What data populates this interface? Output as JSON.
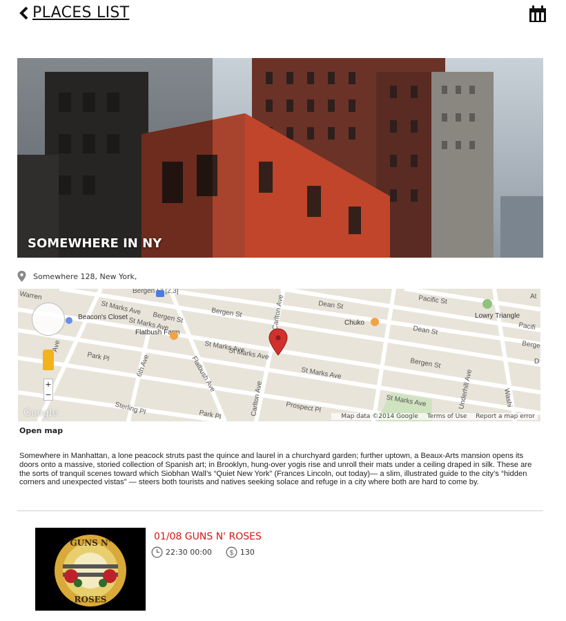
{
  "header": {
    "back_label": "PLACES LIST",
    "back_icon": "chevron-left-icon",
    "calendar_icon": "calendar-icon"
  },
  "place": {
    "title": "SOMEWHERE IN NY",
    "address": "Somewhere 128, New York,",
    "open_map_label": "Open map",
    "description": "Somewhere in Manhattan, a lone peacock struts past the quince and laurel in a churchyard garden; further uptown, a Beaux-Arts mansion opens its doors onto a massive, storied collection of Spanish art; in Brooklyn, hung-over yogis rise and unroll their mats under a ceiling draped in silk. These are the sorts of tranquil scenes toward which Siobhan Wall’s “Quiet New York” (Frances Lincoln, out today)— a slim, illustrated guide to the city’s “hidden corners and unexpected vistas” — steers both tourists and natives seeking solace and refuge in a city where both are hard to come by."
  },
  "map": {
    "streets": [
      "Bergen St",
      "St Marks Ave",
      "Dean St",
      "Pacific St",
      "Park Pl",
      "Sterling Pl",
      "Prospect Pl",
      "Flatbush Ave",
      "6th Ave",
      "Carlton Ave",
      "Underhill Ave",
      "Washi",
      "St Marks Ave",
      "Bergen St",
      "Dean St",
      "Park Pl",
      "At",
      "Pacifi",
      "St Marks Ave",
      "Warren",
      "Bergen St [2,3]",
      "Bergen St",
      "St Marks Ave",
      "Ave",
      "Carlton Ave",
      "D",
      "Bergen St",
      "St Marks Ave",
      "St Marks Ave"
    ],
    "pois": [
      "Beacon's Closet",
      "Flatbush Farm",
      "Chuko",
      "Lowry Triangle"
    ],
    "google_label": "Google",
    "footer": {
      "data": "Map data ©2014 Google",
      "terms": "Terms of Use",
      "report": "Report a map error"
    },
    "zoom_in": "+",
    "zoom_out": "−",
    "pin_color": "#d0312d"
  },
  "event": {
    "date_title": "01/08  GUNS N' ROSES",
    "time": "22:30 00:00",
    "price": "130",
    "time_icon": "clock-icon",
    "price_icon": "dollar-icon",
    "thumb_text_top": "GUNS N'",
    "thumb_text_bottom": "ROSES",
    "title_color": "#d91414"
  }
}
